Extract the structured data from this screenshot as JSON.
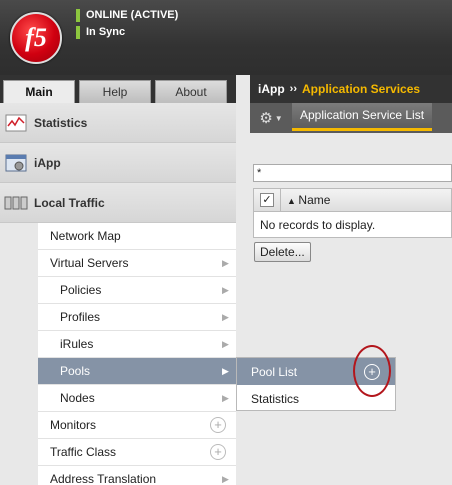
{
  "header": {
    "logo_text": "f5",
    "status_online": "ONLINE (ACTIVE)",
    "status_sync": "In Sync"
  },
  "tabs": [
    "Main",
    "Help",
    "About"
  ],
  "sidebar": {
    "sections": [
      {
        "label": "Statistics",
        "icon": "statistics-icon"
      },
      {
        "label": "iApp",
        "icon": "iapp-icon"
      },
      {
        "label": "Local Traffic",
        "icon": "local-traffic-icon"
      }
    ],
    "items": [
      {
        "label": "Network Map"
      },
      {
        "label": "Virtual Servers"
      },
      {
        "label": "Policies"
      },
      {
        "label": "Profiles"
      },
      {
        "label": "iRules"
      },
      {
        "label": "Pools"
      },
      {
        "label": "Nodes"
      },
      {
        "label": "Monitors"
      },
      {
        "label": "Traffic Class"
      },
      {
        "label": "Address Translation"
      }
    ]
  },
  "flyout": {
    "items": [
      {
        "label": "Pool List"
      },
      {
        "label": "Statistics"
      }
    ]
  },
  "breadcrumb": {
    "root": "iApp",
    "current": "Application Services"
  },
  "subtabs": [
    "Application Service List"
  ],
  "filter": {
    "value": "*"
  },
  "table": {
    "columns": [
      "Name"
    ],
    "empty_text": "No records to display."
  },
  "actions": {
    "delete_label": "Delete..."
  },
  "colors": {
    "accent": "#f5b900",
    "active_nav": "#8593a6",
    "status_ok": "#8dc63f",
    "highlight": "#b3161c"
  }
}
